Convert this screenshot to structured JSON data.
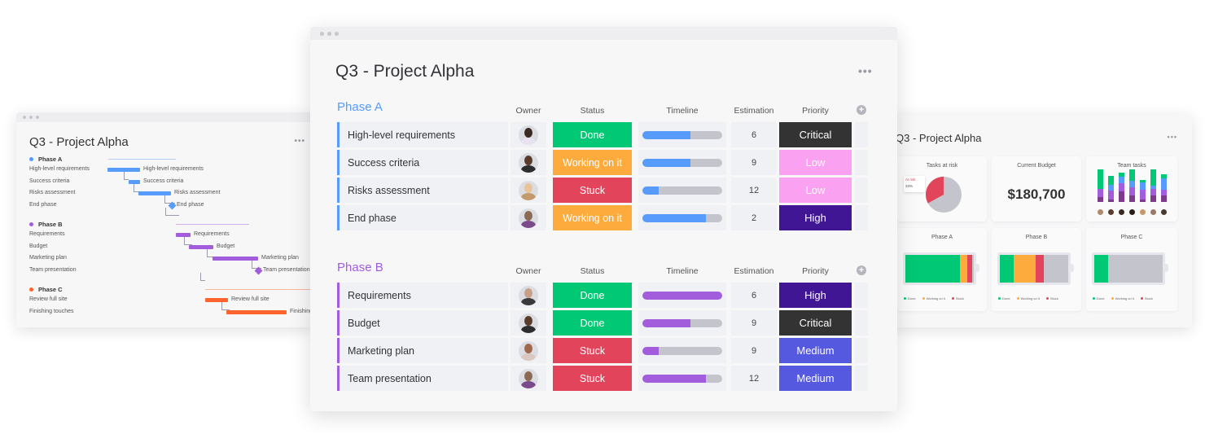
{
  "board": {
    "title": "Q3 - Project Alpha",
    "more_label": "•••",
    "add_column_label": "+",
    "columns": [
      "Owner",
      "Status",
      "Timeline",
      "Estimation",
      "Priority"
    ],
    "groups": [
      {
        "name": "Phase A",
        "color": "#579bfc",
        "rows": [
          {
            "item": "High-level requirements",
            "owner": "owner-1",
            "status": "Done",
            "status_color": "#00c875",
            "timeline_progress": 0.6,
            "estimation": "6",
            "priority": "Critical",
            "priority_color": "#333333"
          },
          {
            "item": "Success criteria",
            "owner": "owner-2",
            "status": "Working on it",
            "status_color": "#fdab3d",
            "timeline_progress": 0.6,
            "estimation": "9",
            "priority": "Low",
            "priority_color": "#faa1f1"
          },
          {
            "item": "Risks assessment",
            "owner": "owner-3",
            "status": "Stuck",
            "status_color": "#e2445c",
            "timeline_progress": 0.2,
            "estimation": "12",
            "priority": "Low",
            "priority_color": "#faa1f1"
          },
          {
            "item": "End phase",
            "owner": "owner-4",
            "status": "Working on it",
            "status_color": "#fdab3d",
            "timeline_progress": 0.8,
            "estimation": "2",
            "priority": "High",
            "priority_color": "#401694"
          }
        ]
      },
      {
        "name": "Phase B",
        "color": "#a25ddc",
        "rows": [
          {
            "item": "Requirements",
            "owner": "owner-5",
            "status": "Done",
            "status_color": "#00c875",
            "timeline_progress": 1.0,
            "estimation": "6",
            "priority": "High",
            "priority_color": "#401694"
          },
          {
            "item": "Budget",
            "owner": "owner-2",
            "status": "Done",
            "status_color": "#00c875",
            "timeline_progress": 0.6,
            "estimation": "9",
            "priority": "Critical",
            "priority_color": "#333333"
          },
          {
            "item": "Marketing plan",
            "owner": "owner-6",
            "status": "Stuck",
            "status_color": "#e2445c",
            "timeline_progress": 0.2,
            "estimation": "9",
            "priority": "Medium",
            "priority_color": "#5559df"
          },
          {
            "item": "Team presentation",
            "owner": "owner-4",
            "status": "Stuck",
            "status_color": "#e2445c",
            "timeline_progress": 0.8,
            "estimation": "12",
            "priority": "Medium",
            "priority_color": "#5559df"
          }
        ]
      }
    ]
  },
  "gantt": {
    "title": "Q3 - Project Alpha",
    "more_label": "•••",
    "phases": [
      {
        "name": "Phase A",
        "color": "#579bfc",
        "items": [
          "High-level requirements",
          "Success criteria",
          "Risks assessment",
          "End phase"
        ]
      },
      {
        "name": "Phase B",
        "color": "#a25ddc",
        "items": [
          "Requirements",
          "Budget",
          "Marketing plan",
          "Team presentation"
        ]
      },
      {
        "name": "Phase C",
        "color": "#ff642e",
        "items": [
          "Review full site",
          "Finishing touches"
        ]
      }
    ],
    "bar_labels": [
      "High-level requirements",
      "Success criteria",
      "Risks assessment",
      "End phase",
      "Requirements",
      "Budget",
      "Marketing plan",
      "Team presentation",
      "Review full site",
      "Finishing touches"
    ]
  },
  "dashboard": {
    "title": "Q3 - Project Alpha",
    "more_label": "•••",
    "tasks_at_risk": {
      "title": "Tasks at risk",
      "tooltip_label": "At risk",
      "tooltip_value": "33%",
      "at_risk_fraction": 0.33
    },
    "current_budget": {
      "title": "Current Budget",
      "value": "$180,700"
    },
    "team_tasks": {
      "title": "Team tasks",
      "stacks": [
        [
          0.15,
          0.25,
          0.0,
          0.6
        ],
        [
          0.1,
          0.35,
          0.2,
          0.35
        ],
        [
          0.35,
          0.3,
          0.2,
          0.15
        ],
        [
          0.2,
          0.25,
          0.2,
          0.35
        ],
        [
          0.1,
          0.45,
          0.35,
          0.1
        ],
        [
          0.2,
          0.2,
          0.1,
          0.5
        ],
        [
          0.25,
          0.2,
          0.4,
          0.15
        ]
      ]
    },
    "phases": [
      {
        "title": "Phase A",
        "done": 0.8,
        "working": 0.11,
        "stuck": 0.07
      },
      {
        "title": "Phase B",
        "done": 0.2,
        "working": 0.32,
        "stuck": 0.12
      },
      {
        "title": "Phase C",
        "done": 0.2,
        "working": 0.0,
        "stuck": 0.0
      }
    ],
    "legend": [
      "Done",
      "Working on it",
      "Stuck"
    ]
  },
  "colors": {
    "done": "#00c875",
    "working": "#fdab3d",
    "stuck": "#e2445c",
    "empty": "#c4c5cc",
    "blue": "#579bfc",
    "purple": "#a25ddc",
    "dark_purple": "#784bd1",
    "deep_purple": "#7e3b8a"
  }
}
